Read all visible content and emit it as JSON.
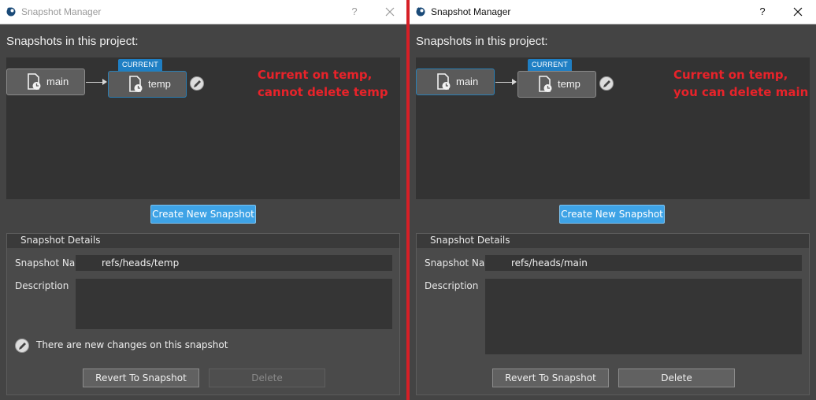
{
  "left_window": {
    "title": "Snapshot Manager",
    "help": "?",
    "section_title": "Snapshots in this project:",
    "nodes": [
      {
        "label": "main"
      },
      {
        "label": "temp"
      }
    ],
    "current_tag": "CURRENT",
    "annotation": [
      "Current on temp,",
      "cannot delete temp"
    ],
    "create_button": "Create New Snapshot",
    "details": {
      "title": "Snapshot Details",
      "name_label": "Snapshot Name",
      "name_value": "refs/heads/temp",
      "description_label": "Description",
      "changes_text": "There are new changes on this snapshot",
      "revert_button": "Revert To Snapshot",
      "delete_button": "Delete",
      "delete_enabled": false
    }
  },
  "right_window": {
    "title": "Snapshot Manager",
    "help": "?",
    "section_title": "Snapshots in this project:",
    "nodes": [
      {
        "label": "main"
      },
      {
        "label": "temp"
      }
    ],
    "current_tag": "CURRENT",
    "annotation": [
      "Current on temp,",
      "you can delete main"
    ],
    "create_button": "Create New Snapshot",
    "details": {
      "title": "Snapshot Details",
      "name_label": "Snapshot Name",
      "name_value": "refs/heads/main",
      "description_label": "Description",
      "revert_button": "Revert To Snapshot",
      "delete_button": "Delete",
      "delete_enabled": true
    }
  },
  "colors": {
    "accent": "#1f7fc4",
    "button_blue": "#3ea3e6",
    "annotation_red": "#e8232a",
    "divider_red": "#d61f26",
    "panel_dark": "#333333",
    "window_bg": "#444444"
  },
  "icons": [
    "app-icon",
    "close-icon",
    "snapshot-icon",
    "pencil-icon"
  ]
}
